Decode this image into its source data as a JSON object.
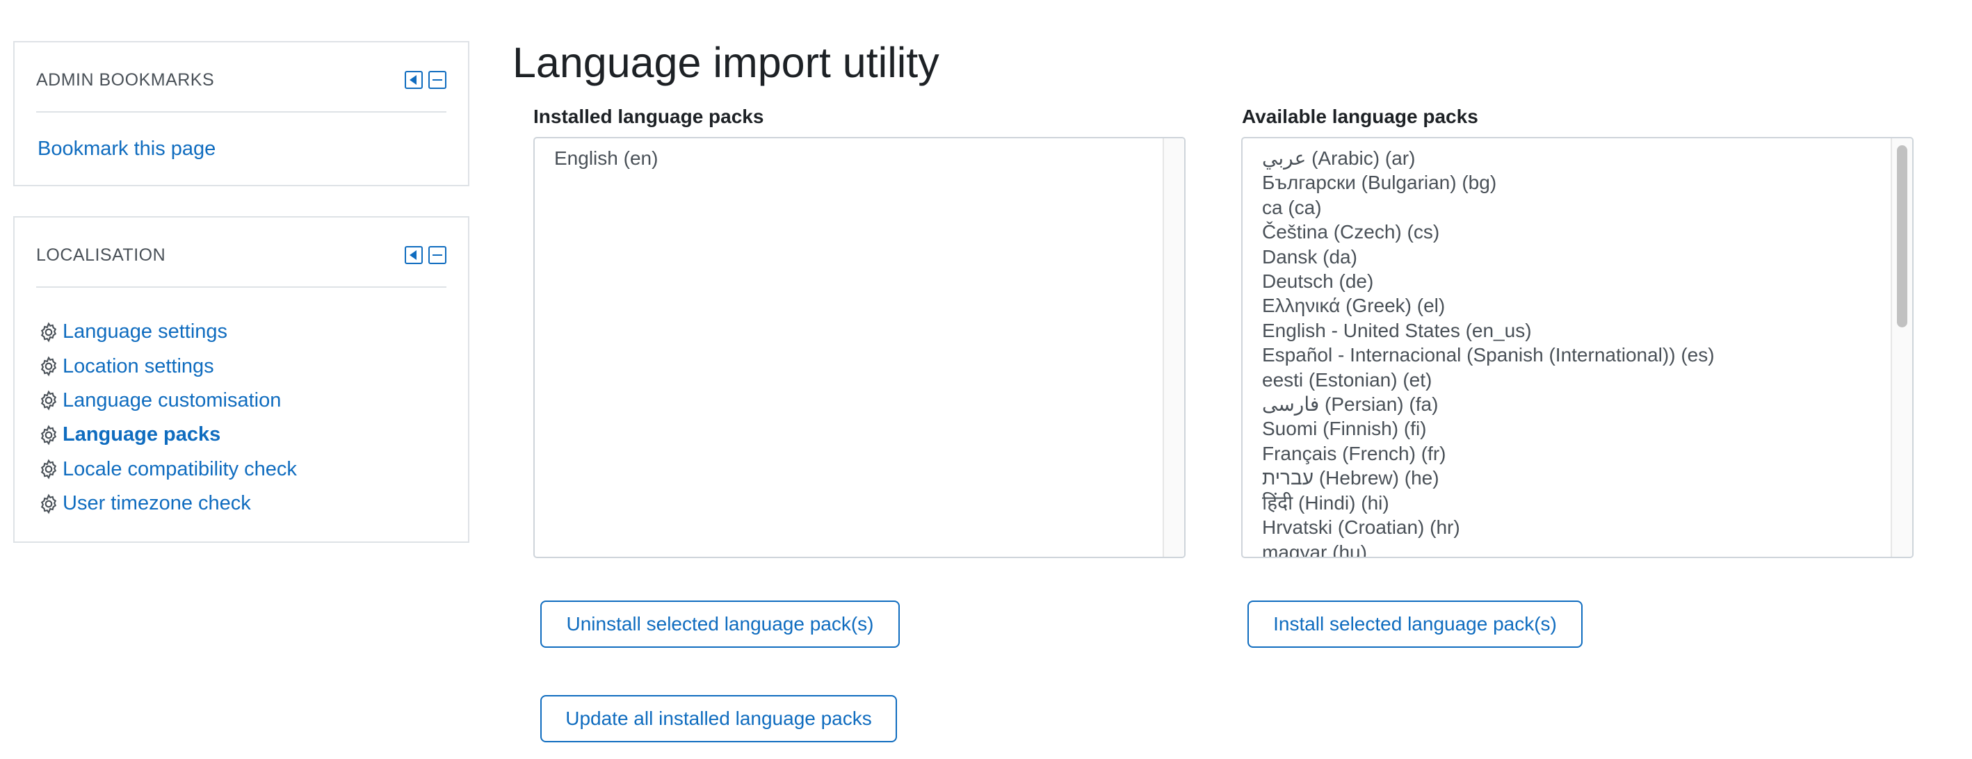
{
  "sidebar": {
    "bookmarks": {
      "title": "ADMIN BOOKMARKS",
      "link": "Bookmark this page",
      "controls": [
        "dock-left-icon",
        "collapse-icon"
      ]
    },
    "localisation": {
      "title": "LOCALISATION",
      "items": [
        {
          "label": "Language settings",
          "icon": "gear-icon"
        },
        {
          "label": "Location settings",
          "icon": "gear-icon"
        },
        {
          "label": "Language customisation",
          "icon": "gear-icon"
        },
        {
          "label": "Language packs",
          "icon": "gear-icon",
          "active": true
        },
        {
          "label": "Locale compatibility check",
          "icon": "gear-icon"
        },
        {
          "label": "User timezone check",
          "icon": "gear-icon"
        }
      ]
    }
  },
  "main": {
    "title": "Language import utility",
    "installed": {
      "label": "Installed language packs",
      "options": [
        "English (en)"
      ]
    },
    "available": {
      "label": "Available language packs",
      "options": [
        "عربي (Arabic) (ar)",
        "Български (Bulgarian) (bg)",
        "ca (ca)",
        "Čeština (Czech) (cs)",
        "Dansk (da)",
        "Deutsch (de)",
        "Ελληνικά (Greek) (el)",
        "English - United States (en_us)",
        "Español - Internacional (Spanish (International)) (es)",
        "eesti (Estonian) (et)",
        "فارسی (Persian) (fa)",
        "Suomi (Finnish) (fi)",
        "Français (French) (fr)",
        "עברית (Hebrew) (he)",
        "हिंदी (Hindi) (hi)",
        "Hrvatski (Croatian) (hr)",
        "magyar (hu)"
      ]
    },
    "buttons": {
      "uninstall": "Uninstall selected language pack(s)",
      "install": "Install selected language pack(s)",
      "update": "Update all installed language packs"
    }
  },
  "colors": {
    "link": "#0f6cbf",
    "border": "#dee2e6",
    "text": "#1d2125",
    "muted": "#495057"
  }
}
